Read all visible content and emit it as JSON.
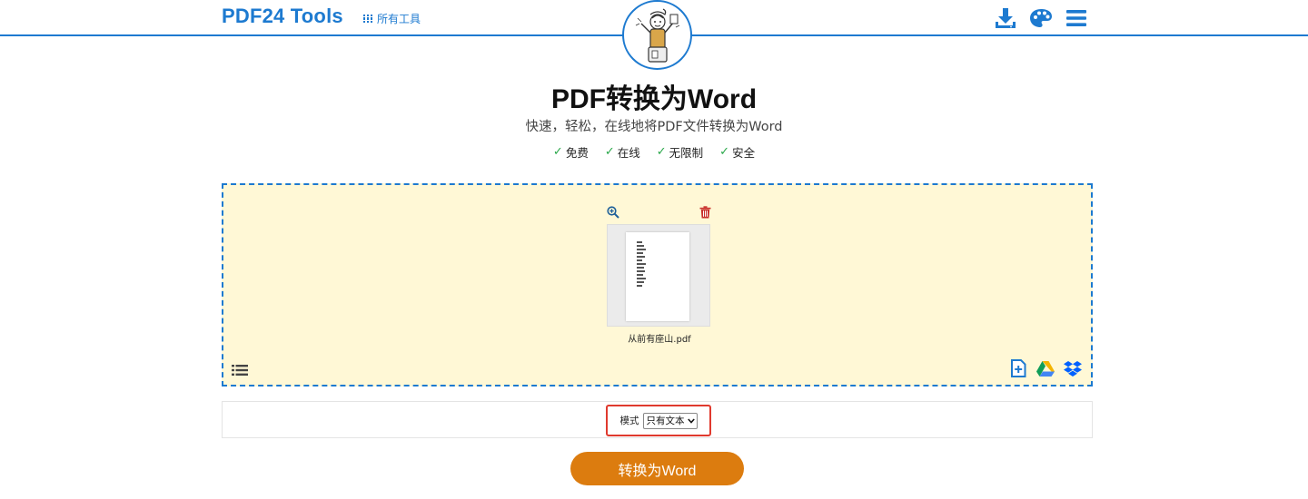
{
  "header": {
    "brand": "PDF24 Tools",
    "all_tools_label": "所有工具",
    "icons": [
      "download-icon",
      "palette-icon",
      "menu-icon"
    ],
    "accent_color": "#1d7ad0"
  },
  "page": {
    "title": "PDF转换为Word",
    "subtitle": "快速，轻松，在线地将PDF文件转换为Word",
    "features": [
      {
        "check": "✓",
        "label": "免费"
      },
      {
        "check": "✓",
        "label": "在线"
      },
      {
        "check": "✓",
        "label": "无限制"
      },
      {
        "check": "✓",
        "label": "安全"
      }
    ]
  },
  "dropzone": {
    "background_color": "#fff8d6",
    "file": {
      "name": "从前有座山.pdf",
      "tools": [
        "zoom-in-icon",
        "trash-icon"
      ]
    },
    "source_icons": [
      "add-file-icon",
      "google-drive-icon",
      "dropbox-icon"
    ],
    "list_view_icon": "list-icon"
  },
  "options": {
    "mode_label": "模式",
    "mode_value": "只有文本",
    "highlight_color": "#e03a2e"
  },
  "convert_button": {
    "label": "转换为Word",
    "color": "#dc7c0f"
  }
}
